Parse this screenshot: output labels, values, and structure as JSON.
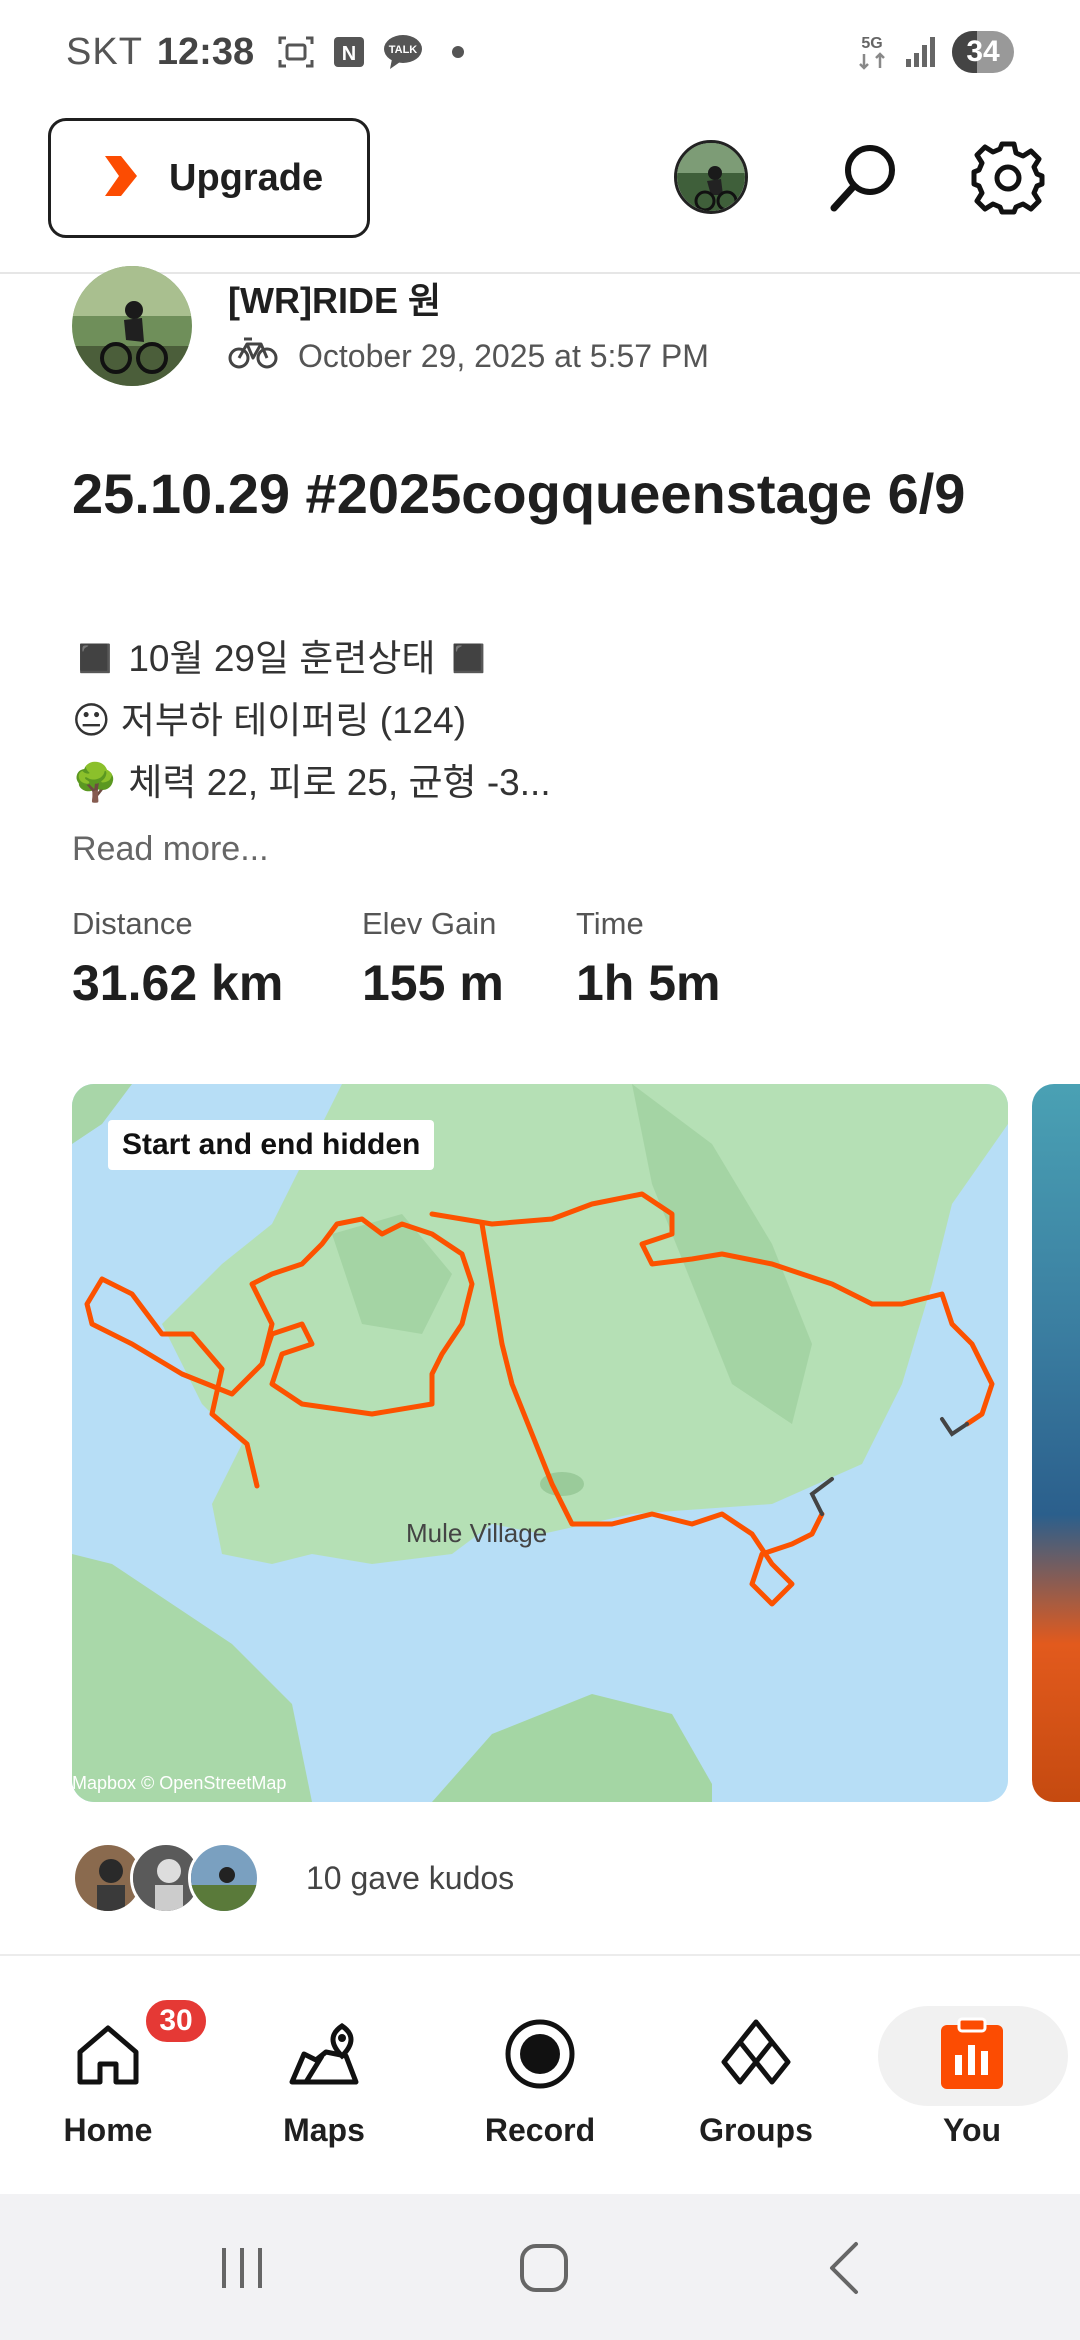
{
  "status_bar": {
    "carrier": "SKT",
    "time": "12:38",
    "network": "5G",
    "battery": "34",
    "icons": [
      "screenshot-icon",
      "naver-icon",
      "talk-icon",
      "dot-icon",
      "5g-icon",
      "signal-icon",
      "battery-icon"
    ],
    "talk_label": "TALK",
    "naver_label": "N"
  },
  "header": {
    "upgrade_label": "Upgrade",
    "accent": "#fc4c02"
  },
  "post": {
    "user_name": "[WR]RIDE 원",
    "timestamp": "October 29, 2025 at 5:57 PM",
    "title": "25.10.29 #2025cogqueenstage 6/9",
    "description_lines": [
      {
        "emoji": "◼️",
        "text": "◼️ 10월 29일 훈련상태 ◼️"
      },
      {
        "emoji": "😐",
        "text": "😐 저부하 테이퍼링 (124)"
      },
      {
        "emoji": "🌳",
        "text": "🌳 체력 22, 피로 25, 균형 -3..."
      }
    ],
    "read_more": "Read more...",
    "stats": [
      {
        "label": "Distance",
        "value": "31.62 km"
      },
      {
        "label": "Elev Gain",
        "value": "155 m"
      },
      {
        "label": "Time",
        "value": "1h 5m"
      }
    ],
    "map": {
      "badge": "Start and end hidden",
      "place_label": "Mule Village",
      "attribution": "Mapbox © OpenStreetMap",
      "route_color": "#fc5200"
    },
    "kudos_text": "10 gave kudos"
  },
  "bottom_nav": {
    "items": [
      {
        "label": "Home",
        "badge": "30"
      },
      {
        "label": "Maps"
      },
      {
        "label": "Record"
      },
      {
        "label": "Groups"
      },
      {
        "label": "You",
        "active": true
      }
    ]
  }
}
